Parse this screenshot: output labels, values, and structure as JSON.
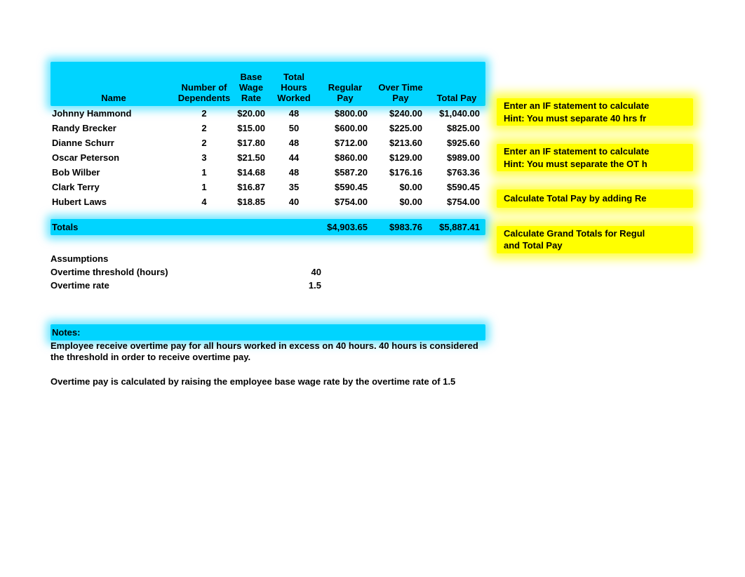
{
  "headers": {
    "name": "Name",
    "dependents": "Number of\nDependents",
    "rate": "Base\nWage\nRate",
    "hours": "Total\nHours\nWorked",
    "regular": "Regular\nPay",
    "overtime": "Over Time\nPay",
    "total": "Total Pay"
  },
  "rows": [
    {
      "name": "Johnny Hammond",
      "dep": "2",
      "rate": "$20.00",
      "hrs": "48",
      "reg": "$800.00",
      "ot": "$240.00",
      "tot": "$1,040.00"
    },
    {
      "name": "Randy Brecker",
      "dep": "2",
      "rate": "$15.00",
      "hrs": "50",
      "reg": "$600.00",
      "ot": "$225.00",
      "tot": "$825.00"
    },
    {
      "name": "Dianne Schurr",
      "dep": "2",
      "rate": "$17.80",
      "hrs": "48",
      "reg": "$712.00",
      "ot": "$213.60",
      "tot": "$925.60"
    },
    {
      "name": "Oscar Peterson",
      "dep": "3",
      "rate": "$21.50",
      "hrs": "44",
      "reg": "$860.00",
      "ot": "$129.00",
      "tot": "$989.00"
    },
    {
      "name": "Bob Wilber",
      "dep": "1",
      "rate": "$14.68",
      "hrs": "48",
      "reg": "$587.20",
      "ot": "$176.16",
      "tot": "$763.36"
    },
    {
      "name": "Clark Terry",
      "dep": "1",
      "rate": "$16.87",
      "hrs": "35",
      "reg": "$590.45",
      "ot": "$0.00",
      "tot": "$590.45"
    },
    {
      "name": "Hubert Laws",
      "dep": "4",
      "rate": "$18.85",
      "hrs": "40",
      "reg": "$754.00",
      "ot": "$0.00",
      "tot": "$754.00"
    }
  ],
  "totals": {
    "label": "Totals",
    "reg": "$4,903.65",
    "ot": "$983.76",
    "tot": "$5,887.41"
  },
  "assumptions": {
    "title": "Assumptions",
    "threshold_label": "Overtime threshold (hours)",
    "threshold_value": "40",
    "rate_label": "Overtime rate",
    "rate_value": "1.5"
  },
  "notes": {
    "title": "Notes:",
    "line1": "Employee receive overtime pay for all hours worked in excess on 40 hours. 40 hours is considered the threshold in order to receive overtime pay.",
    "line2": "Overtime pay is calculated by raising the employee base wage rate by the overtime rate of 1.5"
  },
  "hints": {
    "h1": "Enter an IF statement to calculate\nHint: You must separate 40 hrs fr",
    "h2": "Enter an IF statement to calculate\nHint: You must separate the OT h",
    "h3": "Calculate Total Pay by adding Re",
    "h4": "Calculate Grand Totals for Regul\nand Total Pay"
  }
}
